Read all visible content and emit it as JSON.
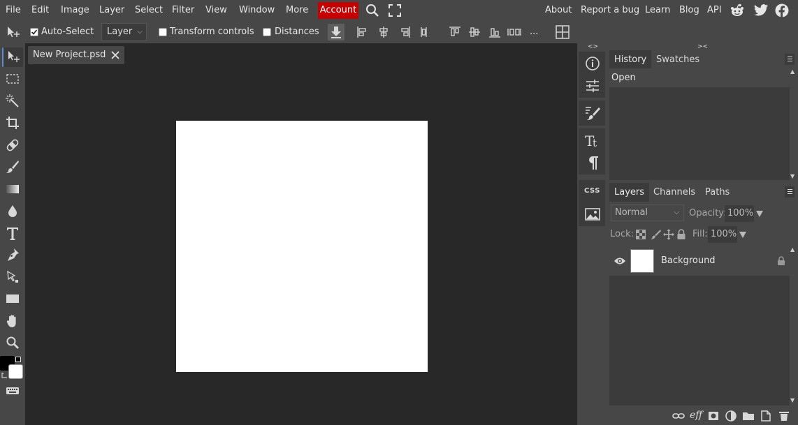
{
  "menu": {
    "items": [
      "File",
      "Edit",
      "Image",
      "Layer",
      "Select",
      "Filter",
      "View",
      "Window",
      "More"
    ],
    "account": "Account",
    "right_links": [
      "About",
      "Report a bug",
      "Learn",
      "Blog",
      "API"
    ]
  },
  "options": {
    "auto_select": "Auto-Select",
    "auto_select_checked": true,
    "target_select": "Layer",
    "transform_controls": "Transform controls",
    "distances": "Distances",
    "more": "..."
  },
  "document": {
    "tab_name": "New Project.psd",
    "canvas_color": "#ffffff"
  },
  "colors": {
    "accent": "#c40000",
    "foreground": "#000000",
    "background": "#ffffff",
    "active_tool": "#5d8bd6"
  },
  "right_icons": {
    "collapse_left": "<>",
    "collapse_right": "><",
    "css_label": "CSS"
  },
  "history_panel": {
    "tabs": [
      "History",
      "Swatches"
    ],
    "entries": [
      "Open"
    ]
  },
  "layers_panel": {
    "tabs": [
      "Layers",
      "Channels",
      "Paths"
    ],
    "blend_mode": "Normal",
    "opacity_label": "Opacity:",
    "opacity_value": "100%",
    "lock_label": "Lock:",
    "fill_label": "Fill:",
    "fill_value": "100%",
    "layers": [
      {
        "name": "Background",
        "visible": true,
        "locked": true
      }
    ],
    "footer_eff": "eff"
  }
}
